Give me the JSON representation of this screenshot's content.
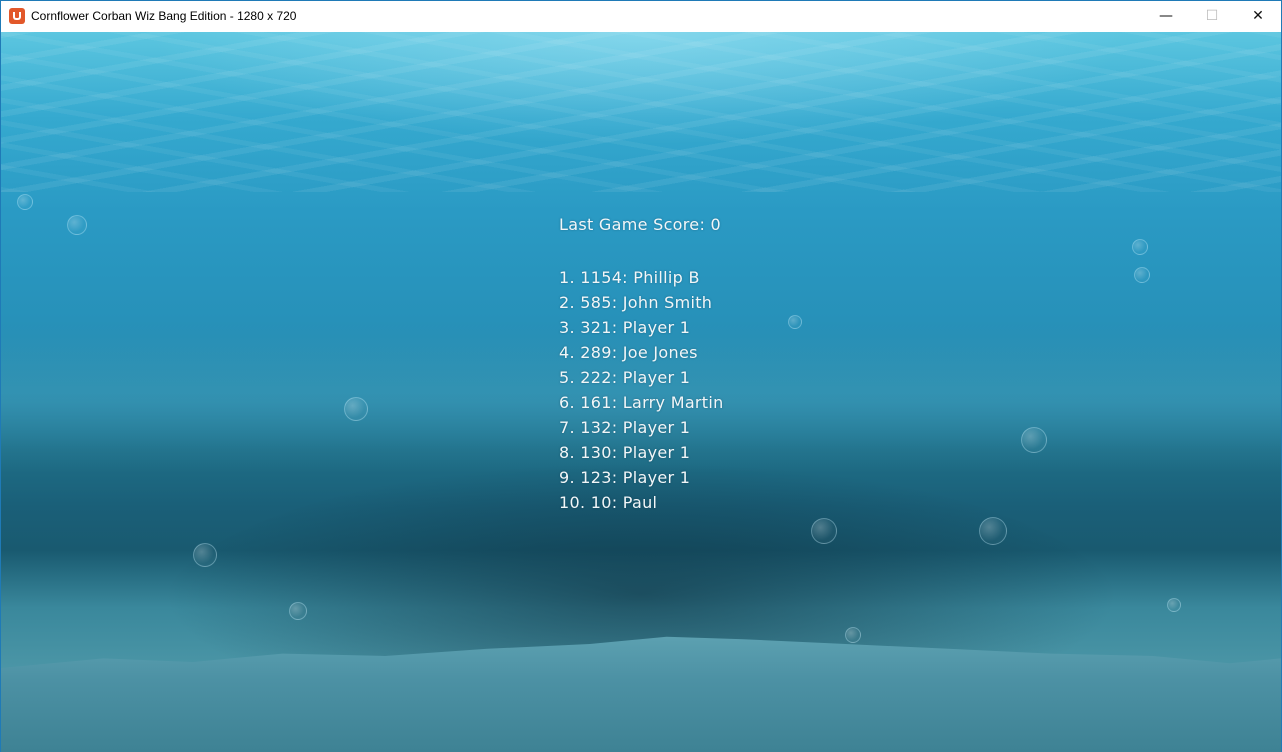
{
  "window": {
    "title": "Cornflower Corban Wiz Bang Edition - 1280 x 720",
    "icon": "monogame-app-icon",
    "controls": {
      "minimize": "—",
      "maximize": "☐",
      "close": "✕"
    }
  },
  "colors": {
    "title_bar": "#ffffff",
    "window_border": "#1f7ab7",
    "text": "#f2f6f8",
    "water_top": "#5cc6e0",
    "water_mid": "#2791b9",
    "sea_floor": "#4c91a4"
  },
  "game": {
    "last_score_label": "Last Game Score: 0",
    "high_scores": [
      {
        "text": "1. 1154: Phillip B"
      },
      {
        "text": "2. 585: John Smith"
      },
      {
        "text": "3. 321: Player 1"
      },
      {
        "text": "4. 289: Joe Jones"
      },
      {
        "text": "5. 222: Player 1"
      },
      {
        "text": "6. 161: Larry Martin"
      },
      {
        "text": "7. 132: Player 1"
      },
      {
        "text": "8. 130: Player 1"
      },
      {
        "text": "9. 123: Player 1"
      },
      {
        "text": "10. 10: Paul"
      }
    ]
  }
}
